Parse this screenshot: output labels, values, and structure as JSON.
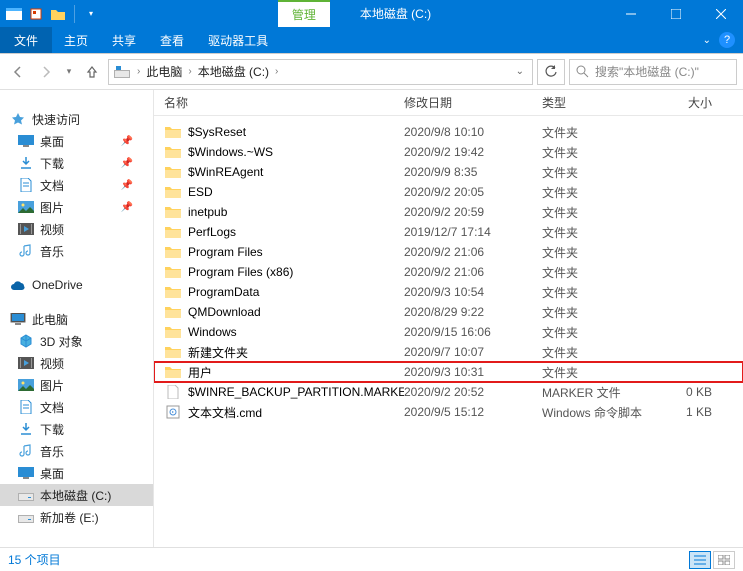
{
  "titlebar": {
    "context_tab": "管理",
    "title": "本地磁盘 (C:)"
  },
  "ribbon": {
    "file": "文件",
    "tabs": [
      "主页",
      "共享",
      "查看"
    ],
    "context_tab": "驱动器工具"
  },
  "nav": {
    "breadcrumb": [
      "此电脑",
      "本地磁盘 (C:)"
    ],
    "search_placeholder": "搜索\"本地磁盘 (C:)\""
  },
  "sidebar": {
    "quick_access": {
      "label": "快速访问",
      "items": [
        {
          "label": "桌面",
          "icon": "desktop",
          "pinned": true
        },
        {
          "label": "下载",
          "icon": "download",
          "pinned": true
        },
        {
          "label": "文档",
          "icon": "document",
          "pinned": true
        },
        {
          "label": "图片",
          "icon": "picture",
          "pinned": true
        },
        {
          "label": "视频",
          "icon": "video",
          "pinned": false
        },
        {
          "label": "音乐",
          "icon": "music",
          "pinned": false
        }
      ]
    },
    "onedrive": {
      "label": "OneDrive"
    },
    "this_pc": {
      "label": "此电脑",
      "items": [
        {
          "label": "3D 对象",
          "icon": "3d"
        },
        {
          "label": "视频",
          "icon": "video"
        },
        {
          "label": "图片",
          "icon": "picture"
        },
        {
          "label": "文档",
          "icon": "document"
        },
        {
          "label": "下载",
          "icon": "download"
        },
        {
          "label": "音乐",
          "icon": "music"
        },
        {
          "label": "桌面",
          "icon": "desktop"
        },
        {
          "label": "本地磁盘 (C:)",
          "icon": "drive",
          "selected": true
        },
        {
          "label": "新加卷 (E:)",
          "icon": "drive"
        }
      ]
    }
  },
  "columns": {
    "name": "名称",
    "date": "修改日期",
    "type": "类型",
    "size": "大小"
  },
  "files": [
    {
      "name": "$SysReset",
      "date": "2020/9/8 10:10",
      "type": "文件夹",
      "size": "",
      "icon": "folder"
    },
    {
      "name": "$Windows.~WS",
      "date": "2020/9/2 19:42",
      "type": "文件夹",
      "size": "",
      "icon": "folder"
    },
    {
      "name": "$WinREAgent",
      "date": "2020/9/9 8:35",
      "type": "文件夹",
      "size": "",
      "icon": "folder"
    },
    {
      "name": "ESD",
      "date": "2020/9/2 20:05",
      "type": "文件夹",
      "size": "",
      "icon": "folder"
    },
    {
      "name": "inetpub",
      "date": "2020/9/2 20:59",
      "type": "文件夹",
      "size": "",
      "icon": "folder"
    },
    {
      "name": "PerfLogs",
      "date": "2019/12/7 17:14",
      "type": "文件夹",
      "size": "",
      "icon": "folder"
    },
    {
      "name": "Program Files",
      "date": "2020/9/2 21:06",
      "type": "文件夹",
      "size": "",
      "icon": "folder"
    },
    {
      "name": "Program Files (x86)",
      "date": "2020/9/2 21:06",
      "type": "文件夹",
      "size": "",
      "icon": "folder"
    },
    {
      "name": "ProgramData",
      "date": "2020/9/3 10:54",
      "type": "文件夹",
      "size": "",
      "icon": "folder"
    },
    {
      "name": "QMDownload",
      "date": "2020/8/29 9:22",
      "type": "文件夹",
      "size": "",
      "icon": "folder"
    },
    {
      "name": "Windows",
      "date": "2020/9/15 16:06",
      "type": "文件夹",
      "size": "",
      "icon": "folder"
    },
    {
      "name": "新建文件夹",
      "date": "2020/9/7 10:07",
      "type": "文件夹",
      "size": "",
      "icon": "folder"
    },
    {
      "name": "用户",
      "date": "2020/9/3 10:31",
      "type": "文件夹",
      "size": "",
      "icon": "folder",
      "highlight": true
    },
    {
      "name": "$WINRE_BACKUP_PARTITION.MARKER",
      "date": "2020/9/2 20:52",
      "type": "MARKER 文件",
      "size": "0 KB",
      "icon": "file"
    },
    {
      "name": "文本文档.cmd",
      "date": "2020/9/5 15:12",
      "type": "Windows 命令脚本",
      "size": "1 KB",
      "icon": "cmd"
    }
  ],
  "status": {
    "count_label": "15 个项目"
  }
}
